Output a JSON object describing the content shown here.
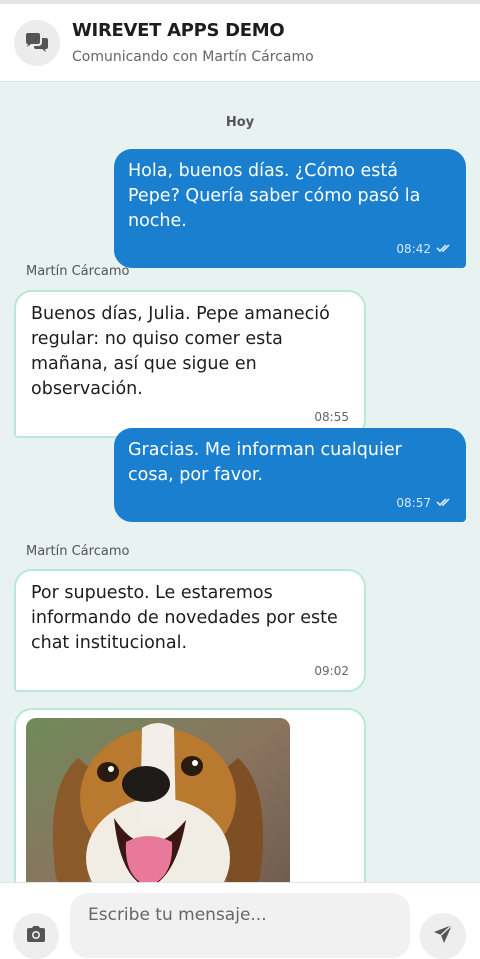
{
  "header": {
    "avatar_icon": "chat-bubbles-icon",
    "title": "WIREVET APPS DEMO",
    "subtitle": "Comunicando con Martín Cárcamo"
  },
  "chat": {
    "day_label": "Hoy",
    "messages": [
      {
        "direction": "out",
        "text": "Hola, buenos días. ¿Cómo está Pepe? Quería saber cómo pasó la noche.",
        "time": "08:42",
        "status_icon": "double-check-icon"
      },
      {
        "direction": "in",
        "sender": "Martín Cárcamo",
        "text": "Buenos días, Julia. Pepe amaneció regular: no quiso comer esta mañana, así que sigue en observación.",
        "time": "08:55"
      },
      {
        "direction": "out",
        "text": "Gracias. Me informan cualquier cosa, por favor.",
        "time": "08:57",
        "status_icon": "double-check-icon"
      },
      {
        "direction": "in",
        "sender": "Martín Cárcamo",
        "text": "Por supuesto. Le estaremos informando de novedades por este chat institucional.",
        "time": "09:02"
      },
      {
        "direction": "in",
        "type": "image",
        "image": "beagle-dog-photo"
      }
    ]
  },
  "composer": {
    "placeholder": "Escribe tu mensaje...",
    "camera_icon": "camera-icon",
    "send_icon": "send-icon"
  },
  "colors": {
    "outgoing_bubble": "#1a7fcf",
    "incoming_border": "#b9e7dc",
    "chat_background": "#e8f2f0"
  }
}
